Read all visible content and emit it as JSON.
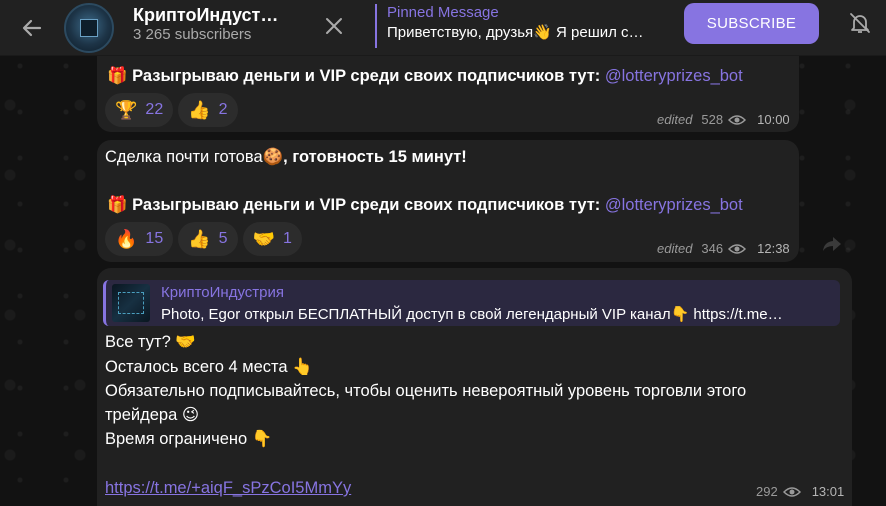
{
  "header": {
    "channel_name": "КриптоИндуст…",
    "subscribers": "3 265 subscribers",
    "pinned_title": "Pinned Message",
    "pinned_text": "Приветствую, друзья👋 Я решил с…",
    "subscribe_label": "SUBSCRIBE"
  },
  "messages": [
    {
      "gift_emoji": "🎁",
      "text": "Разыгрываю деньги и VIP среди своих подписчиков тут: ",
      "mention": "@lotteryprizes_bot",
      "reactions": [
        {
          "emoji": "🏆",
          "count": "22"
        },
        {
          "emoji": "👍",
          "count": "2"
        }
      ],
      "edited": "edited",
      "views": "528",
      "time": "10:00"
    },
    {
      "line1_text": "Сделка почти готова",
      "line1_emoji": "🍪",
      "line1_bold": ", готовность 15 минут!",
      "gift_emoji": "🎁",
      "text": "Разыгрываю деньги и VIP среди своих подписчиков тут: ",
      "mention": "@lotteryprizes_bot",
      "reactions": [
        {
          "emoji": "🔥",
          "count": "15"
        },
        {
          "emoji": "👍",
          "count": "5"
        },
        {
          "emoji": "🤝",
          "count": "1"
        }
      ],
      "edited": "edited",
      "views": "346",
      "time": "12:38"
    },
    {
      "reply_name": "КриптоИндустрия",
      "reply_text": "Photo, Egor открыл БЕСПЛАТНЫЙ доступ в свой легендарный VIP канал👇  https://t.me…",
      "lines": [
        "Все тут? 🤝",
        "Осталось всего 4 места 👆",
        "Обязательно подписывайтесь, чтобы оценить невероятный уровень торговли этого",
        "трейдера 😉",
        "Время ограничено 👇"
      ],
      "url": "https://t.me/+aiqF_sPzCoI5MmYy",
      "views": "292",
      "time": "13:01"
    }
  ],
  "colors": {
    "accent": "#8774e1",
    "bubble": "#212121",
    "header": "#212121"
  },
  "icons": {
    "back": "arrow-left-icon",
    "close": "close-icon",
    "mute": "bell-off-icon",
    "views": "eye-icon",
    "share": "share-icon"
  }
}
